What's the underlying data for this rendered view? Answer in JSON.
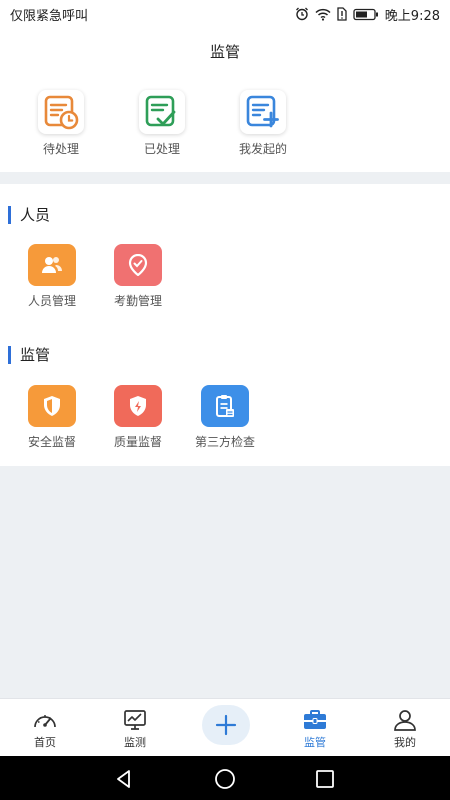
{
  "status": {
    "carrier": "仅限紧急呼叫",
    "time": "晚上9:28"
  },
  "header": {
    "title": "监管"
  },
  "quick_actions": [
    {
      "label": "待处理",
      "icon": "clipboard-clock-icon",
      "color": "#e8893a"
    },
    {
      "label": "已处理",
      "icon": "clipboard-check-icon",
      "color": "#2e9e58"
    },
    {
      "label": "我发起的",
      "icon": "clipboard-plus-icon",
      "color": "#3a86dc"
    }
  ],
  "sections": [
    {
      "title": "人员",
      "items": [
        {
          "label": "人员管理",
          "icon": "people-icon",
          "color": "#f69a3a"
        },
        {
          "label": "考勤管理",
          "icon": "location-check-icon",
          "color": "#f07171"
        }
      ]
    },
    {
      "title": "监管",
      "items": [
        {
          "label": "安全监督",
          "icon": "shield-icon",
          "color": "#f69a3a"
        },
        {
          "label": "质量监督",
          "icon": "shield-bolt-icon",
          "color": "#f06a5a"
        },
        {
          "label": "第三方检查",
          "icon": "clipboard-list-icon",
          "color": "#3d8fe8"
        }
      ]
    }
  ],
  "tabbar": {
    "tabs": [
      {
        "label": "首页",
        "icon": "dashboard-icon"
      },
      {
        "label": "监测",
        "icon": "monitor-chart-icon"
      },
      {
        "label": "监管",
        "icon": "briefcase-icon",
        "active": true
      },
      {
        "label": "我的",
        "icon": "user-icon"
      }
    ],
    "accent": "#2e7ad6"
  }
}
